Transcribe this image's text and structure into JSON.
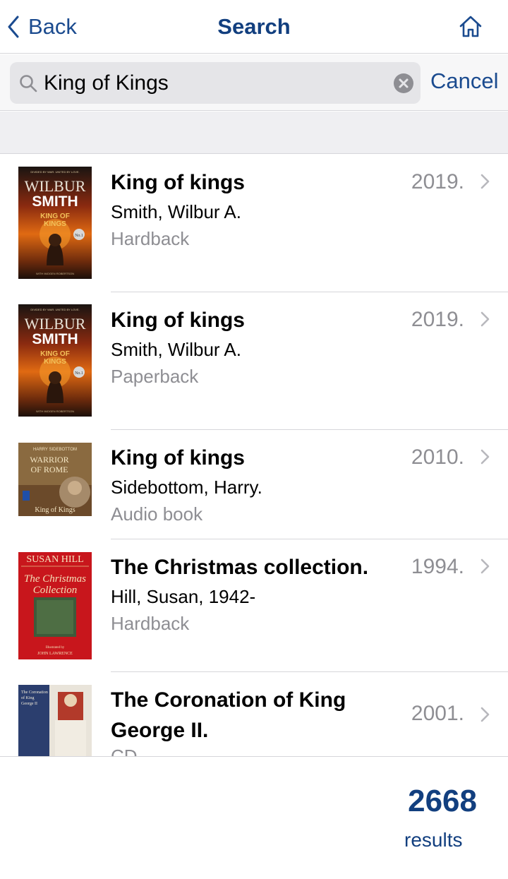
{
  "nav": {
    "back_label": "Back",
    "title": "Search"
  },
  "search": {
    "query": "King of Kings",
    "placeholder": "Search",
    "cancel_label": "Cancel"
  },
  "results": [
    {
      "title": "King of kings",
      "author": "Smith, Wilbur A.",
      "format": "Hardback",
      "year": "2019.",
      "cover": {
        "top_text": "DIVIDED BY WAR. UNITED BY LOVE.",
        "author_first": "WILBUR",
        "author_last": "SMITH",
        "book_title": "KING OF KINGS",
        "badge": "No.1",
        "coauthor": "WITH IMOGEN ROBERTSON"
      }
    },
    {
      "title": "King of kings",
      "author": "Smith, Wilbur A.",
      "format": "Paperback",
      "year": "2019.",
      "cover": {
        "top_text": "DIVIDED BY WAR. UNITED BY LOVE.",
        "author_first": "WILBUR",
        "author_last": "SMITH",
        "book_title": "KING OF KINGS",
        "badge": "No.1",
        "coauthor": "WITH IMOGEN ROBERTSON"
      }
    },
    {
      "title": "King of kings",
      "author": "Sidebottom, Harry.",
      "format": "Audio book",
      "year": "2010.",
      "cover": {
        "author_name": "HARRY SIDEBOTTOM",
        "series": "WARRIOR OF ROME",
        "book_title": "King of Kings"
      }
    },
    {
      "title": "The Christmas collection.",
      "author": "Hill, Susan, 1942-",
      "format": "Hardback",
      "year": "1994.",
      "cover": {
        "author_name": "SUSAN HILL",
        "book_title_1": "The Christmas",
        "book_title_2": "Collection",
        "credit_1": "Illustrated by",
        "credit_2": "JOHN LAWRENCE"
      }
    },
    {
      "title_line1": "The Coronation of King",
      "title_line2": "George II.",
      "format": "CD",
      "year": "2001.",
      "cover": {
        "line1": "The Coronation",
        "line2": "of King",
        "line3": "George II"
      }
    }
  ],
  "footer": {
    "count": "2668",
    "label": "results"
  },
  "colors": {
    "brand": "#123f7f",
    "link": "#1b4b8f",
    "secondary_text": "#8e8e93",
    "separator": "#d6d6da"
  }
}
